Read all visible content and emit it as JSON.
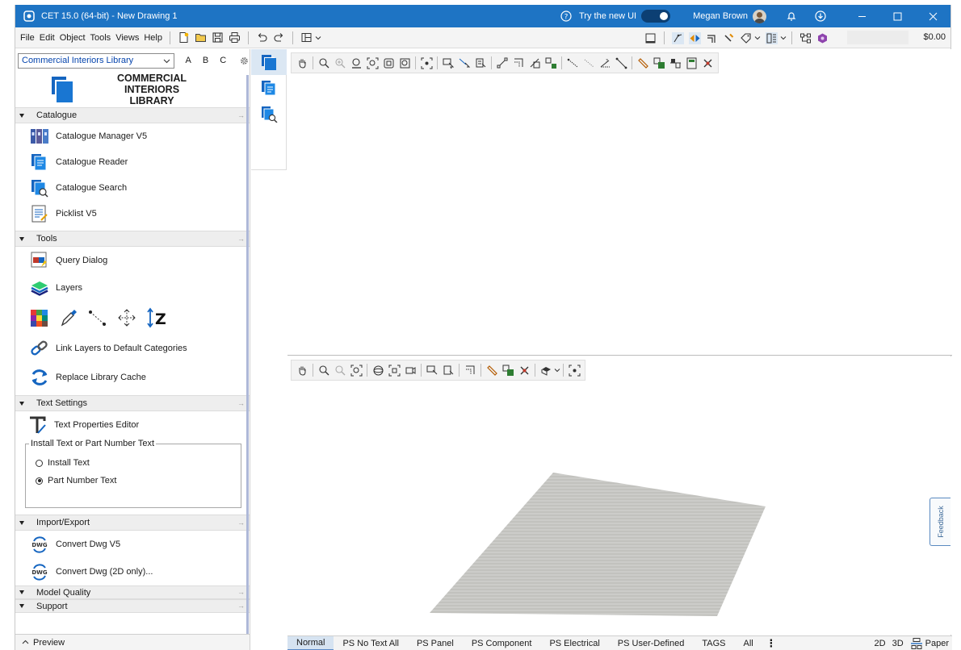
{
  "titlebar": {
    "title": "CET 15.0 (64-bit) - New Drawing 1",
    "try_new_ui": "Try the new UI",
    "toggle_on": true,
    "user": "Megan Brown"
  },
  "menubar": {
    "items": [
      "File",
      "Edit",
      "Object",
      "Tools",
      "Views",
      "Help"
    ],
    "price": "$0.00"
  },
  "library": {
    "selected": "Commercial Interiors Library",
    "letters": [
      "A",
      "B",
      "C"
    ],
    "title_line1": "COMMERCIAL INTERIORS",
    "title_line2": "LIBRARY"
  },
  "sections": {
    "catalogue": {
      "name": "Catalogue",
      "items": [
        "Catalogue Manager V5",
        "Catalogue Reader",
        "Catalogue Search",
        "Picklist V5"
      ]
    },
    "tools": {
      "name": "Tools",
      "items": [
        "Query Dialog",
        "Layers",
        "Link Layers to Default Categories",
        "Replace Library Cache"
      ]
    },
    "text_settings": {
      "name": "Text Settings",
      "editor": "Text Properties Editor",
      "group_label": "Install Text or Part Number Text",
      "options": [
        "Install Text",
        "Part Number Text"
      ],
      "selected_index": 1
    },
    "import_export": {
      "name": "Import/Export",
      "items": [
        "Convert Dwg V5",
        "Convert Dwg (2D only)..."
      ]
    },
    "model_quality": {
      "name": "Model Quality"
    },
    "support": {
      "name": "Support"
    }
  },
  "preview": {
    "label": "Preview"
  },
  "feedback": {
    "label": "Feedback"
  },
  "bottom_tabs": {
    "items": [
      "Normal",
      "PS No Text All",
      "PS Panel",
      "PS Component",
      "PS Electrical",
      "PS User-Defined",
      "TAGS",
      "All"
    ],
    "active_index": 0,
    "view_2d": "2D",
    "view_3d": "3D",
    "paper": "Paper"
  },
  "colors": {
    "titlebar": "#1e74c4",
    "accent": "#1565c0",
    "floor": "#c9c9c6"
  }
}
